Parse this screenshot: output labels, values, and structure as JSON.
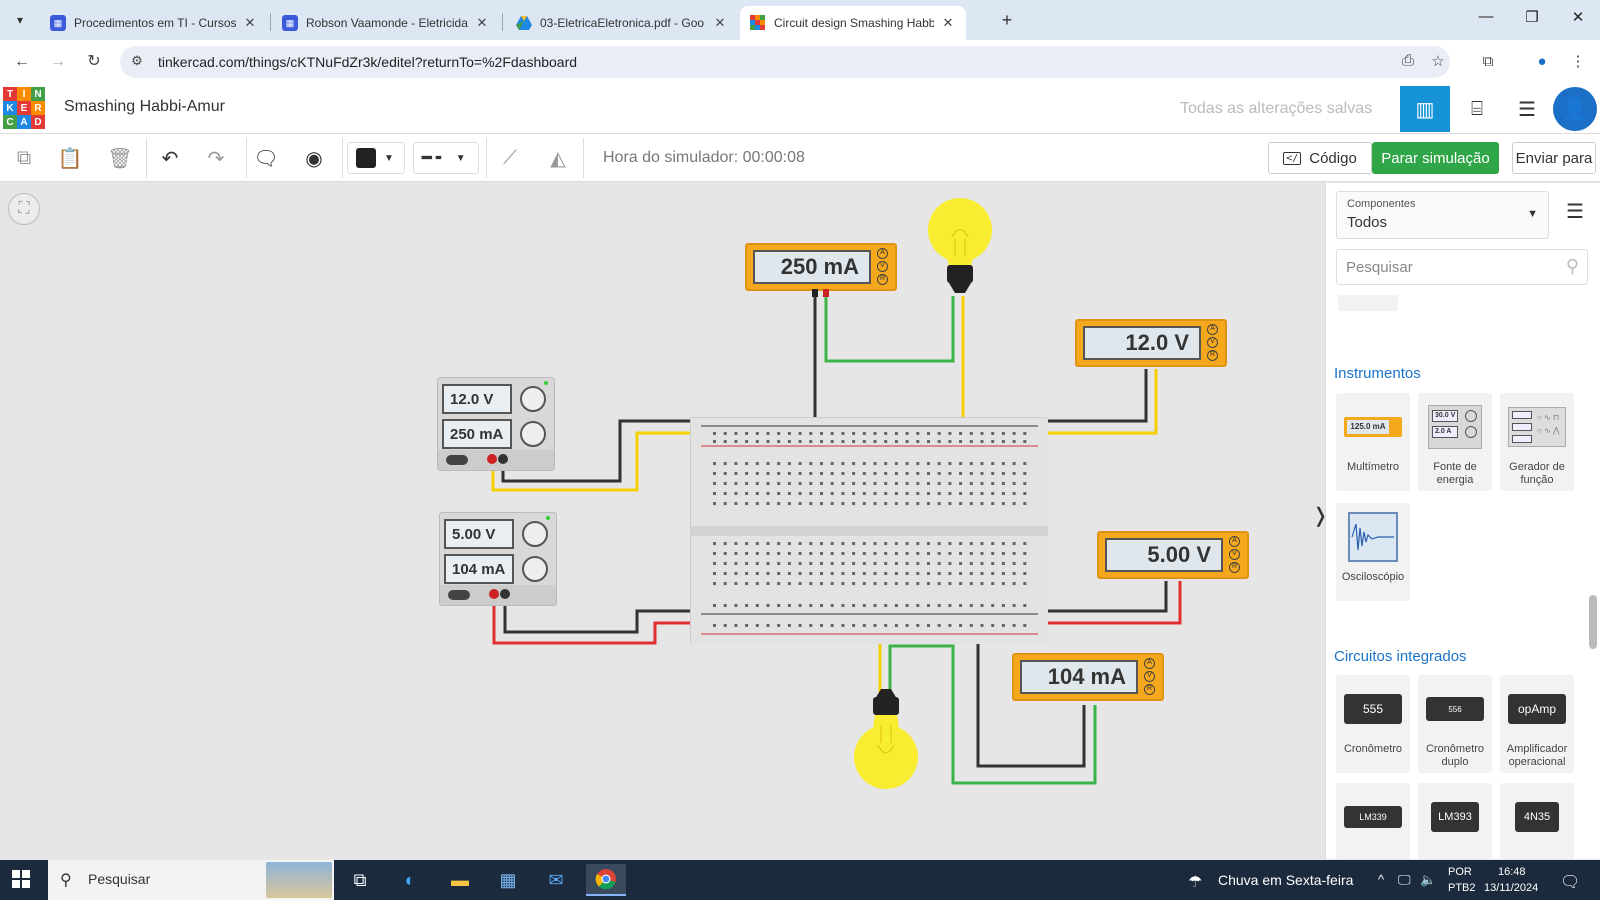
{
  "browser": {
    "tabs": [
      {
        "title": "Procedimentos em TI - Cursos T",
        "favicon_color": "#3b5bdb"
      },
      {
        "title": "Robson Vaamonde - Eletricidad",
        "favicon_color": "#3b5bdb"
      },
      {
        "title": "03-EletricaEletronica.pdf - Goo",
        "favicon_color": "#f5b400"
      },
      {
        "title": "Circuit design Smashing Habbi-",
        "favicon_color": "#e53935"
      }
    ],
    "url": "tinkercad.com/things/cKTNuFdZr3k/editel?returnTo=%2Fdashboard"
  },
  "header": {
    "logo_letters": [
      "T",
      "I",
      "N",
      "K",
      "E",
      "R",
      "C",
      "A",
      "D"
    ],
    "project_title": "Smashing Habbi-Amur",
    "save_status": "Todas as alterações salvas"
  },
  "toolbar": {
    "sim_time": "Hora do simulador: 00:00:08",
    "code_label": "Código",
    "code_icon": "</",
    "stop_sim_label": "Parar simulação",
    "send_label": "Enviar para"
  },
  "circuit": {
    "meter_top": "250 mA",
    "meter_right_top": "12.0 V",
    "meter_right_bottom": "5.00 V",
    "meter_bottom": "104 mA",
    "psu_top": {
      "voltage": "12.0 V",
      "current": "250 mA"
    },
    "psu_bottom": {
      "voltage": "5.00 V",
      "current": "104 mA"
    },
    "meter_knobs": [
      "A",
      "V",
      "R"
    ]
  },
  "panel": {
    "components_label": "Componentes",
    "components_value": "Todos",
    "search_placeholder": "Pesquisar",
    "section_instruments": "Instrumentos",
    "section_ics": "Circuitos integrados",
    "instruments": [
      {
        "label": "Multímetro",
        "thumb": "125.0 mA"
      },
      {
        "label": "Fonte de energia",
        "thumb": "30.0 V"
      },
      {
        "label": "Gerador de função",
        "thumb": ""
      },
      {
        "label": "Osciloscópio",
        "thumb": ""
      }
    ],
    "psu_thumb_current": "2.0 A",
    "ics": [
      {
        "label": "Cronômetro",
        "chip": "555"
      },
      {
        "label": "Cronômetro duplo",
        "chip": "556"
      },
      {
        "label": "Amplificador operacional",
        "chip": "opAmp"
      },
      {
        "label": "",
        "chip": "LM339"
      },
      {
        "label": "",
        "chip": "LM393"
      },
      {
        "label": "",
        "chip": "4N35"
      }
    ]
  },
  "taskbar": {
    "search_placeholder": "Pesquisar",
    "weather": "Chuva em Sexta-feira",
    "lang": "POR",
    "layout": "PTB2",
    "time": "16:48",
    "date": "13/11/2024"
  }
}
